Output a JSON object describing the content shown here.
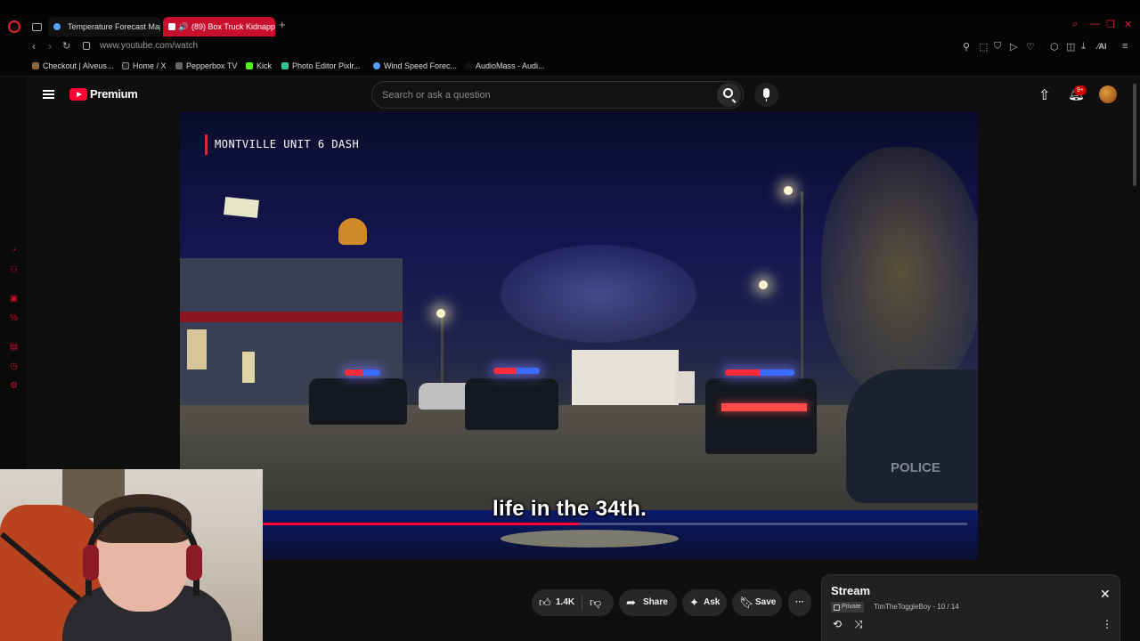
{
  "browser": {
    "tabs": [
      {
        "label": "Temperature Forecast Map"
      },
      {
        "label": "(89) Box Truck Kidnapp"
      }
    ],
    "url": "www.youtube.com/watch",
    "bookmarks": [
      {
        "label": "Checkout | Alveus...",
        "color": "#8a6a40"
      },
      {
        "label": "Home / X",
        "color": "#222222"
      },
      {
        "label": "Pepperbox TV",
        "color": "#666666"
      },
      {
        "label": "Kick",
        "color": "#53fc18"
      },
      {
        "label": "Photo Editor Pixlr...",
        "color": "#31c48d"
      },
      {
        "label": "Wind Speed Forec...",
        "color": "#5aa0ff"
      },
      {
        "label": "AudioMass - Audi...",
        "color": "#111111"
      }
    ],
    "icons": [
      "opera-icon",
      "tabs-icon",
      "back-icon",
      "forward-icon",
      "reload-icon",
      "lock-icon"
    ],
    "accent": "#c8102e"
  },
  "youtube": {
    "brand": "Premium",
    "search_placeholder": "Search or ask a question",
    "notification_count": "9+",
    "video": {
      "overlay_title": "MONTVILLE UNIT 6 DASH",
      "caption": "life in the 34th.",
      "progress_fraction": 0.5
    },
    "actions": {
      "likes": "1.4K",
      "share": "Share",
      "ask": "Ask",
      "save": "Save"
    },
    "playlist": {
      "title": "Stream",
      "privacy": "Private",
      "meta": "TimTheToggleBoy - 10 / 14"
    }
  }
}
